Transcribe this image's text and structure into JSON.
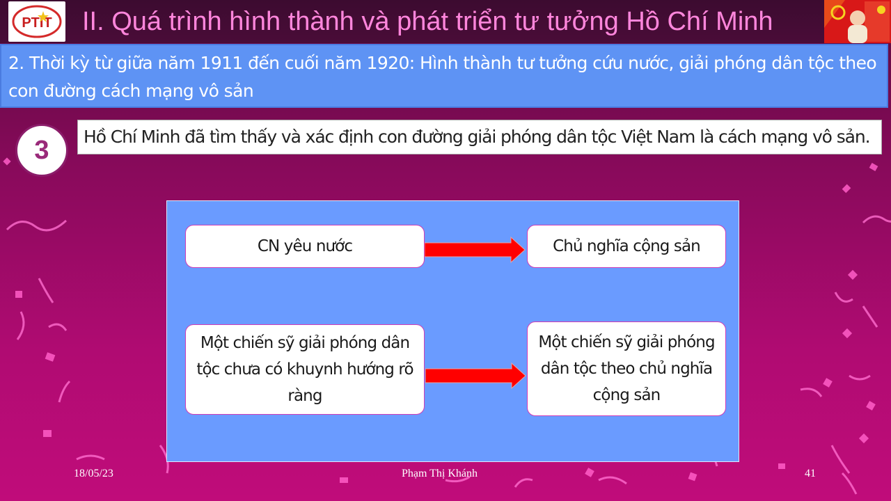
{
  "header": {
    "logo_text": "PTIT",
    "title": "II. Quá trình hình thành và phát triển tư tưởng Hồ Chí Minh"
  },
  "subtitle": "2. Thời kỳ từ giữa năm 1911 đến cuối năm 1920: Hình thành tư tưởng cứu nước, giải phóng dân tộc theo con đường cách mạng vô sản",
  "point": {
    "number": "3",
    "text": "Hồ Chí Minh đã tìm thấy và xác định con đường giải phóng dân tộc Việt Nam là cách mạng vô sản."
  },
  "diagram": {
    "row1": {
      "from": "CN yêu nước",
      "to": "Chủ nghĩa cộng sản"
    },
    "row2": {
      "from": "Một chiến sỹ giải phóng dân tộc chưa có khuynh hướng rõ ràng",
      "to": "Một chiến sỹ giải phóng dân tộc theo chủ nghĩa cộng sản"
    },
    "arrow_color": "#ff0000"
  },
  "footer": {
    "date": "18/05/23",
    "author": "Phạm Thị Khánh",
    "page": "41"
  },
  "colors": {
    "title": "#ff86dc",
    "subtitle_bg": "#5e93f4",
    "diagram_bg": "#6a9bff",
    "background": "#b00b72"
  }
}
